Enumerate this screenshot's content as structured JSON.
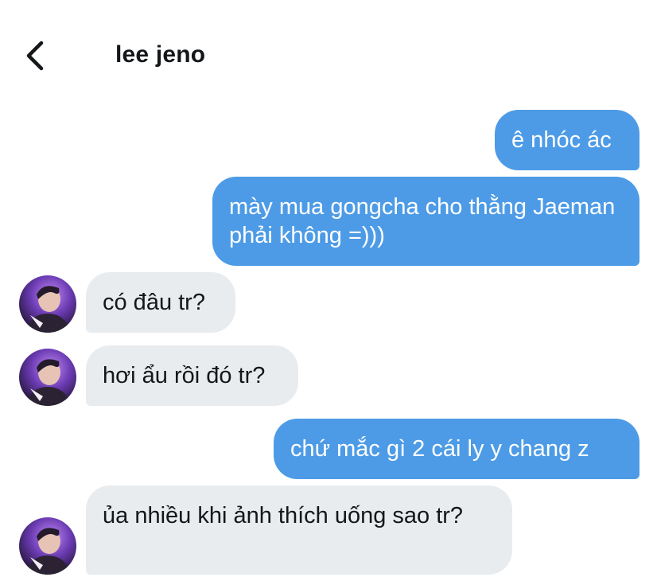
{
  "header": {
    "back_icon": "chevron-left-icon",
    "contact_name": "lee jeno"
  },
  "messages": [
    {
      "direction": "outgoing",
      "text": "ê nhóc ác"
    },
    {
      "direction": "outgoing",
      "text": "mày mua gongcha cho thằng Jaeman phải không =)))"
    },
    {
      "direction": "incoming",
      "text": "có đâu tr?"
    },
    {
      "direction": "incoming",
      "text": "hơi ẩu rồi đó tr?"
    },
    {
      "direction": "outgoing",
      "text": "chứ mắc gì 2 cái ly y chang z"
    },
    {
      "direction": "incoming",
      "text": "ủa nhiều khi ảnh thích uống sao tr?"
    }
  ],
  "colors": {
    "outgoing_bubble": "#4d9be6",
    "incoming_bubble": "#e8ecef",
    "text_dark": "#14171a"
  }
}
